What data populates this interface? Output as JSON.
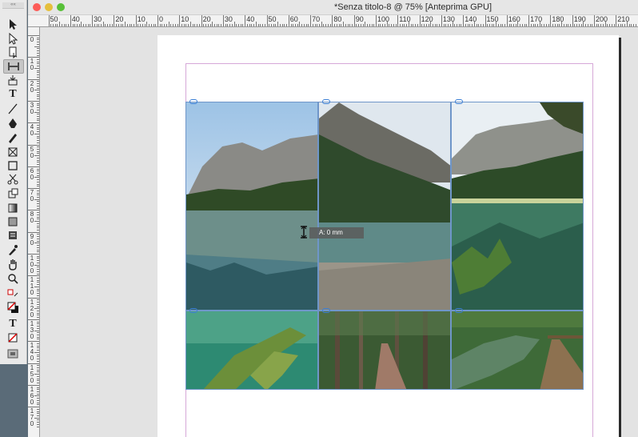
{
  "window": {
    "title": "*Senza titolo-8 @ 75% [Anteprima GPU]",
    "close_color": "#fc5b57",
    "minimize_color": "#e5bf3c",
    "zoom_color": "#57c038"
  },
  "toolbar": {
    "tools": [
      {
        "name": "selection-tool-icon"
      },
      {
        "name": "direct-selection-tool-icon"
      },
      {
        "name": "page-tool-icon"
      },
      {
        "name": "gap-tool-icon",
        "active": true
      },
      {
        "name": "content-collector-icon"
      },
      {
        "name": "type-tool-icon",
        "label": "T"
      },
      {
        "name": "line-tool-icon"
      },
      {
        "name": "pen-tool-icon"
      },
      {
        "name": "pencil-tool-icon"
      },
      {
        "name": "rectangle-frame-tool-icon"
      },
      {
        "name": "rectangle-tool-icon"
      },
      {
        "name": "scissors-tool-icon"
      },
      {
        "name": "free-transform-tool-icon"
      },
      {
        "name": "gradient-swatch-tool-icon"
      },
      {
        "name": "gradient-feather-tool-icon"
      },
      {
        "name": "note-tool-icon"
      },
      {
        "name": "eyedropper-tool-icon"
      },
      {
        "name": "hand-tool-icon"
      },
      {
        "name": "zoom-tool-icon"
      },
      {
        "name": "swap-colors-icon"
      },
      {
        "name": "fill-stroke-icon"
      },
      {
        "name": "formatting-container-icon",
        "label": "T"
      },
      {
        "name": "apply-none-icon"
      },
      {
        "name": "screen-mode-icon"
      }
    ]
  },
  "ruler": {
    "horizontal_labels": [
      "50",
      "40",
      "30",
      "20",
      "10",
      "0",
      "10",
      "20",
      "30",
      "40",
      "50",
      "60",
      "70",
      "80",
      "90",
      "100",
      "110",
      "120",
      "130",
      "140",
      "150",
      "160",
      "170",
      "180",
      "190",
      "200",
      "210"
    ],
    "vertical_labels": [
      "0",
      "1 0",
      "2 0",
      "3 0",
      "4 0",
      "5 0",
      "6 0",
      "7 0",
      "8 0",
      "9 0",
      "1 0 0",
      "1 1 0",
      "1 2 0",
      "1 3 0",
      "1 4 0",
      "1 5 0",
      "1 6 0",
      "1 7 0"
    ]
  },
  "canvas": {
    "gap_tooltip": "A: 0 mm",
    "images": [
      {
        "name": "lake-mountain-reflection-image"
      },
      {
        "name": "mountain-lake-shore-image"
      },
      {
        "name": "green-lake-tree-branch-image"
      },
      {
        "name": "green-water-branch-image"
      },
      {
        "name": "forest-path-image"
      },
      {
        "name": "forest-stream-boardwalk-image"
      }
    ]
  }
}
